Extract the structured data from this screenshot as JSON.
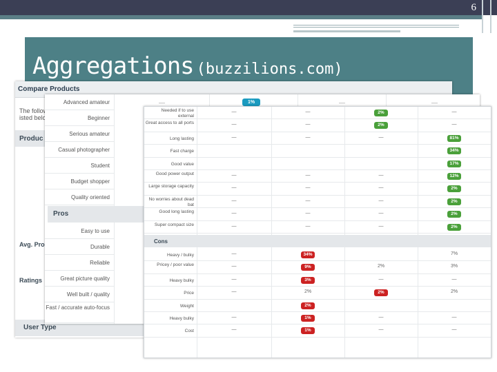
{
  "slide": {
    "page_number": "6",
    "title_main": "Aggregations",
    "title_sub": "(buzzilions.com)"
  },
  "back_panel": {
    "header": "Compare Products",
    "intro_line1": "The follow",
    "intro_line2": "isted belo",
    "section_products": "Produc",
    "label_avg": "Avg. Pro",
    "label_ratings": "Ratings",
    "section_user_type": "User Type"
  },
  "mid_panel": {
    "rows": [
      "Advanced amateur",
      "Beginner",
      "Serious amateur",
      "Casual photographer",
      "Student",
      "Budget shopper",
      "Quality oriented"
    ],
    "pros_section": "Pros",
    "pros_rows": [
      "Easy to use",
      "Durable",
      "Reliable",
      "Great picture quality",
      "Well built / quality",
      "Fast / accurate auto-focus"
    ],
    "badge_advanced": "1%",
    "dash": "—"
  },
  "front_panel": {
    "pros_rows": [
      {
        "label": "Needed if to use external",
        "cells": [
          "—",
          "—",
          "2%",
          "—"
        ],
        "hl": [
          null,
          null,
          "green",
          null
        ]
      },
      {
        "label": "Great access to all ports",
        "cells": [
          "—",
          "—",
          "2%",
          "—"
        ],
        "hl": [
          null,
          null,
          "green",
          null
        ]
      },
      {
        "label": "Long lasting",
        "cells": [
          "—",
          "—",
          "—",
          "81%"
        ],
        "hl": [
          null,
          null,
          null,
          "green"
        ]
      },
      {
        "label": "Fast charge",
        "cells": [
          "",
          "",
          "",
          "34%"
        ],
        "hl": [
          null,
          null,
          null,
          "green"
        ]
      },
      {
        "label": "Good value",
        "cells": [
          "",
          "",
          "",
          "17%"
        ],
        "hl": [
          null,
          null,
          null,
          "green"
        ]
      },
      {
        "label": "Good power output",
        "cells": [
          "—",
          "—",
          "—",
          "12%"
        ],
        "hl": [
          null,
          null,
          null,
          "green"
        ]
      },
      {
        "label": "Large storage capacity",
        "cells": [
          "—",
          "—",
          "—",
          "2%"
        ],
        "hl": [
          null,
          null,
          null,
          "green"
        ]
      },
      {
        "label": "No worries about dead bat",
        "cells": [
          "—",
          "—",
          "—",
          "2%"
        ],
        "hl": [
          null,
          null,
          null,
          "green"
        ]
      },
      {
        "label": "Good long lasting",
        "cells": [
          "—",
          "—",
          "—",
          "2%"
        ],
        "hl": [
          null,
          null,
          null,
          "green"
        ]
      },
      {
        "label": "Super compact size",
        "cells": [
          "—",
          "—",
          "—",
          "2%"
        ],
        "hl": [
          null,
          null,
          null,
          "green"
        ]
      }
    ],
    "cons_section": "Cons",
    "cons_rows": [
      {
        "label": "Heavy / bulky",
        "cells": [
          "—",
          "34%",
          "",
          "7%"
        ],
        "hl": [
          null,
          "red",
          null,
          null
        ]
      },
      {
        "label": "Pricey / poor value",
        "cells": [
          "—",
          "9%",
          "2%",
          "3%"
        ],
        "hl": [
          null,
          "red",
          null,
          null
        ]
      },
      {
        "label": "Heavy bulky",
        "cells": [
          "—",
          "3%",
          "—",
          "—"
        ],
        "hl": [
          null,
          "red",
          null,
          null
        ]
      },
      {
        "label": "Price",
        "cells": [
          "—",
          "2%",
          "2%",
          "2%"
        ],
        "hl": [
          null,
          null,
          "red",
          null
        ]
      },
      {
        "label": "Weight",
        "cells": [
          "",
          "2%",
          "",
          ""
        ],
        "hl": [
          null,
          "red",
          null,
          null
        ]
      },
      {
        "label": "Heavy bulky",
        "cells": [
          "—",
          "1%",
          "—",
          "—"
        ],
        "hl": [
          null,
          "red",
          null,
          null
        ]
      },
      {
        "label": "Cost",
        "cells": [
          "—",
          "1%",
          "—",
          "—"
        ],
        "hl": [
          null,
          "red",
          null,
          null
        ]
      }
    ]
  }
}
